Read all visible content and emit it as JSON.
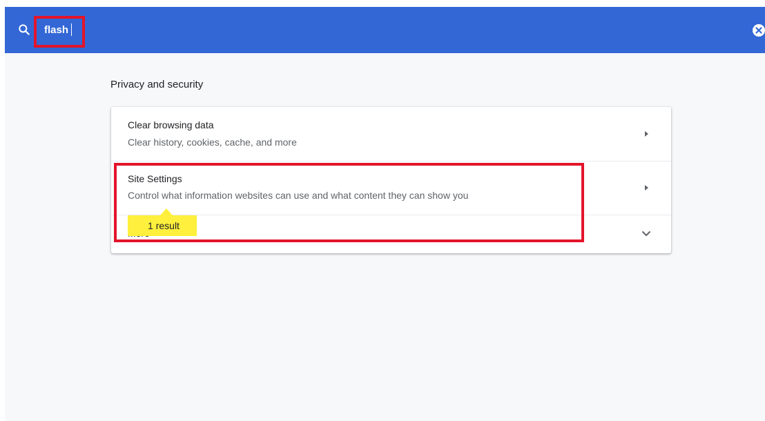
{
  "search": {
    "value": "flash",
    "icon": "search-icon",
    "clear_icon": "clear-icon"
  },
  "section": {
    "title": "Privacy and security"
  },
  "rows": [
    {
      "title": "Clear browsing data",
      "subtitle": "Clear history, cookies, cache, and more",
      "icon": "arrow-right-icon"
    },
    {
      "title": "Site Settings",
      "subtitle": "Control what information websites can use and what content they can show you",
      "icon": "arrow-right-icon"
    },
    {
      "title": "More",
      "icon": "chevron-down-icon"
    }
  ],
  "search_result": {
    "label": "1 result"
  },
  "colors": {
    "search_bar": "#3367d6",
    "highlight": "#e3142a",
    "result_bubble": "#fef03c",
    "page_background": "#f7f8fa"
  }
}
